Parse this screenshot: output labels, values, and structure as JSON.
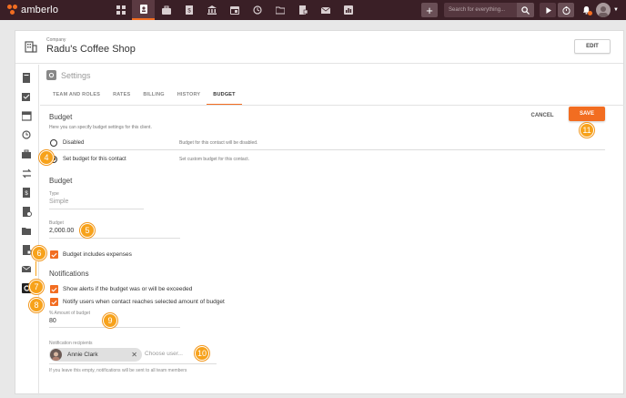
{
  "app": {
    "logo_text": "amberlo",
    "search_placeholder": "Search for everything...",
    "notification_count": "1"
  },
  "nav_icons": [
    "dashboard-icon",
    "contacts-icon",
    "matters-icon",
    "invoices-icon",
    "bank-icon",
    "calendar-icon",
    "time-icon",
    "folder-icon",
    "documents-icon",
    "mail-icon",
    "reports-icon"
  ],
  "company": {
    "label": "Company",
    "name": "Radu's Coffee Shop",
    "edit_label": "EDIT"
  },
  "settings": {
    "title": "Settings",
    "tabs": [
      {
        "label": "TEAM AND ROLES",
        "active": false
      },
      {
        "label": "RATES",
        "active": false
      },
      {
        "label": "BILLING",
        "active": false
      },
      {
        "label": "HISTORY",
        "active": false
      },
      {
        "label": "BUDGET",
        "active": true
      }
    ]
  },
  "actions": {
    "cancel": "CANCEL",
    "save": "SAVE"
  },
  "budget_section": {
    "title": "Budget",
    "description": "Here you can specify budget settings for this client.",
    "options": [
      {
        "label": "Disabled",
        "hint": "Budget for this contact will be disabled.",
        "checked": false
      },
      {
        "label": "Set budget for this contact",
        "hint": "Set custom budget for this contact.",
        "checked": true
      }
    ]
  },
  "budget_fields": {
    "title": "Budget",
    "type_label": "Type",
    "type_value": "Simple",
    "amount_label": "Budget",
    "amount_value": "2,000.00",
    "includes_expenses": "Budget includes expenses"
  },
  "notifications": {
    "title": "Notifications",
    "alert_exceeded": "Show alerts if the budget was or will be exceeded",
    "notify_users": "Notify users when contact reaches selected amount of budget",
    "percent_label": "% Amount of budget",
    "percent_value": "80",
    "recipients_label": "Notification recipients",
    "recipient_name": "Annie Clark",
    "choose_placeholder": "Choose user...",
    "footnote": "If you leave this empty, notifications will be sent to all team members"
  },
  "callouts": [
    "4",
    "5",
    "6",
    "7",
    "8",
    "9",
    "10",
    "11"
  ],
  "colors": {
    "accent": "#f26d21",
    "topbar": "#3a1f26",
    "callout": "#f7a21b"
  }
}
